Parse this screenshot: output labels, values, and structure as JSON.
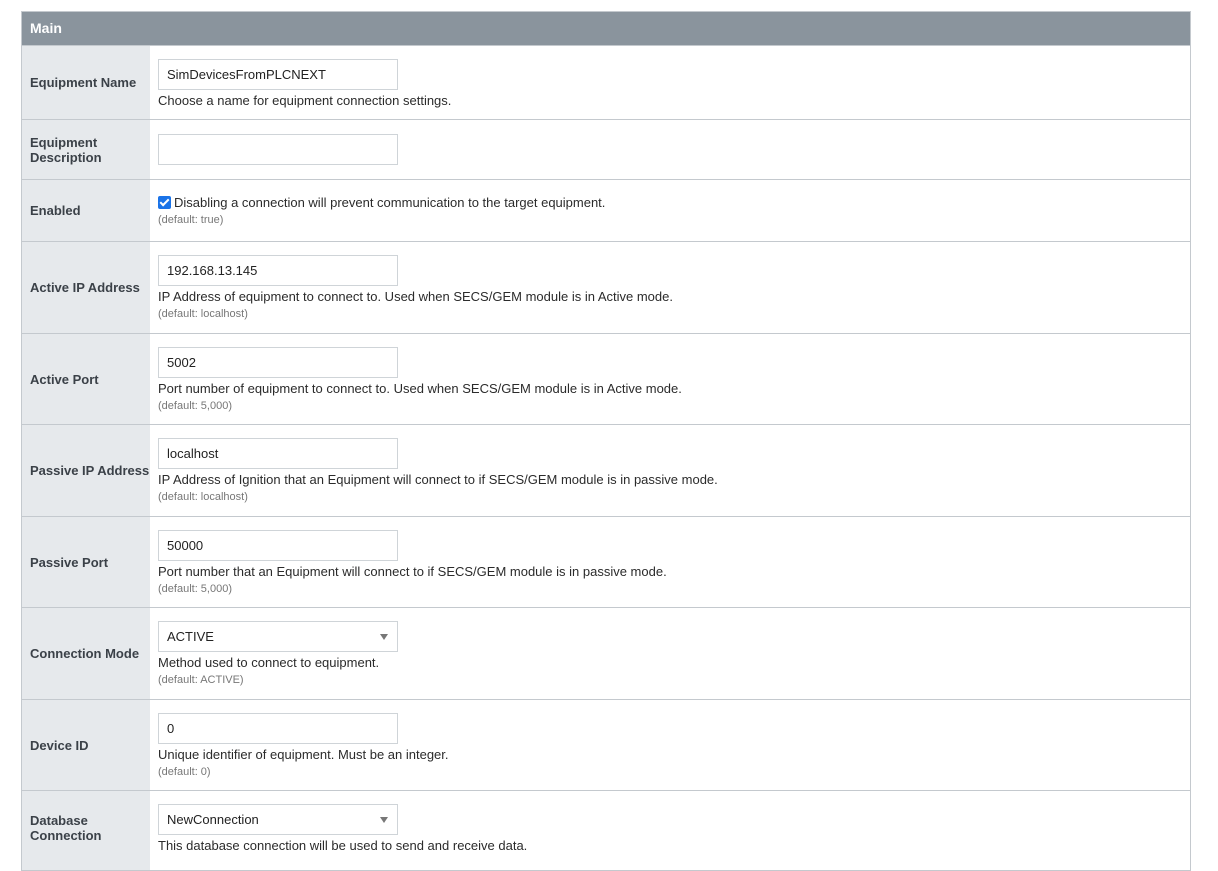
{
  "section": {
    "title": "Main"
  },
  "fields": {
    "equipment_name": {
      "label": "Equipment Name",
      "value": "SimDevicesFromPLCNEXT",
      "description": "Choose a name for equipment connection settings."
    },
    "equipment_description": {
      "label": "Equipment Description",
      "value": ""
    },
    "enabled": {
      "label": "Enabled",
      "checked": true,
      "description": "Disabling a connection will prevent communication to the target equipment.",
      "default": "(default: true)"
    },
    "active_ip": {
      "label": "Active IP Address",
      "value": "192.168.13.145",
      "description": "IP Address of equipment to connect to. Used when SECS/GEM module is in Active mode.",
      "default": "(default: localhost)"
    },
    "active_port": {
      "label": "Active Port",
      "value": "5002",
      "description": "Port number of equipment to connect to. Used when SECS/GEM module is in Active mode.",
      "default": "(default: 5,000)"
    },
    "passive_ip": {
      "label": "Passive IP Address",
      "value": "localhost",
      "description": "IP Address of Ignition that an Equipment will connect to if SECS/GEM module is in passive mode.",
      "default": "(default: localhost)"
    },
    "passive_port": {
      "label": "Passive Port",
      "value": "50000",
      "description": "Port number that an Equipment will connect to if SECS/GEM module is in passive mode.",
      "default": "(default: 5,000)"
    },
    "connection_mode": {
      "label": "Connection Mode",
      "value": "ACTIVE",
      "description": "Method used to connect to equipment.",
      "default": "(default: ACTIVE)"
    },
    "device_id": {
      "label": "Device ID",
      "value": "0",
      "description": "Unique identifier of equipment. Must be an integer.",
      "default": "(default: 0)"
    },
    "database_connection": {
      "label": "Database Connection",
      "value": "NewConnection",
      "description": "This database connection will be used to send and receive data."
    }
  },
  "colors": {
    "header_bg": "#8a949d",
    "label_bg": "#e6e9ec",
    "border": "#c4c9ce",
    "checkbox": "#1a73e8"
  }
}
